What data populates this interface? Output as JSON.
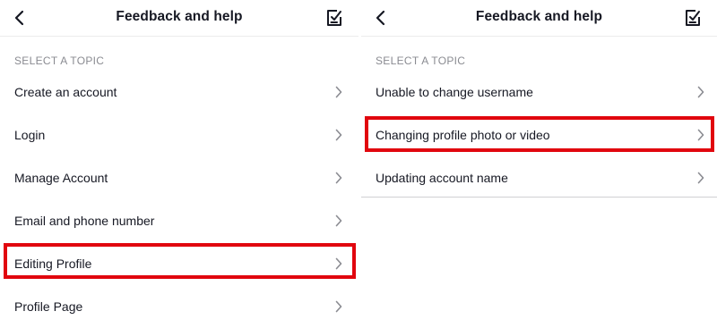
{
  "left": {
    "title": "Feedback and help",
    "section_label": "SELECT A TOPIC",
    "items": [
      {
        "label": "Create an account"
      },
      {
        "label": "Login"
      },
      {
        "label": "Manage Account"
      },
      {
        "label": "Email and phone number"
      },
      {
        "label": "Editing Profile"
      },
      {
        "label": "Profile Page"
      }
    ],
    "highlighted_item": "Editing Profile"
  },
  "right": {
    "title": "Feedback and help",
    "section_label": "SELECT A TOPIC",
    "items": [
      {
        "label": "Unable to change username"
      },
      {
        "label": "Changing profile photo or video"
      },
      {
        "label": "Updating account name"
      }
    ],
    "highlighted_item": "Changing profile photo or video"
  },
  "icons": {
    "back": "back-arrow-icon",
    "edit": "edit-note-icon",
    "chevron": "chevron-right-icon"
  },
  "colors": {
    "highlight": "#e1060e",
    "text": "#161823",
    "section": "#8a8b91"
  }
}
